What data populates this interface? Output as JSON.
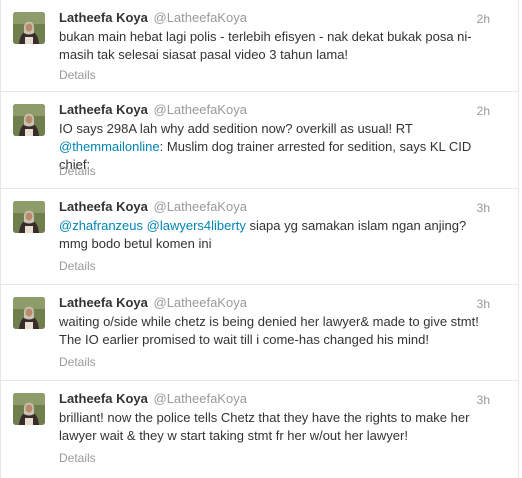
{
  "tweets": [
    {
      "fullname": "Latheefa Koya",
      "username": "@LatheefaKoya",
      "time": "2h",
      "parts": [
        {
          "type": "text",
          "value": "bukan main hebat lagi polis - terlebih efisyen - nak dekat bukak posa ni- masih tak selesai siasat pasal video 3 tahun lama!"
        }
      ],
      "details": "Details"
    },
    {
      "fullname": "Latheefa Koya",
      "username": "@LatheefaKoya",
      "time": "2h",
      "parts": [
        {
          "type": "text",
          "value": "IO says 298A lah why add sedition now? overkill as usual! RT "
        },
        {
          "type": "mention",
          "value": "@themmailonline"
        },
        {
          "type": "text",
          "value": ": Muslim dog trainer arrested for sedition, says KL CID chief:"
        }
      ],
      "details": "Details"
    },
    {
      "fullname": "Latheefa Koya",
      "username": "@LatheefaKoya",
      "time": "3h",
      "parts": [
        {
          "type": "mention",
          "value": "@zhafranzeus"
        },
        {
          "type": "text",
          "value": " "
        },
        {
          "type": "mention",
          "value": "@lawyers4liberty"
        },
        {
          "type": "text",
          "value": " siapa yg samakan islam ngan anjing? mmg bodo betul komen ini"
        }
      ],
      "details": "Details"
    },
    {
      "fullname": "Latheefa Koya",
      "username": "@LatheefaKoya",
      "time": "3h",
      "parts": [
        {
          "type": "text",
          "value": "waiting o/side while chetz is being denied her lawyer& made to give stmt! The IO earlier promised to wait till i come-has changed his mind!"
        }
      ],
      "details": "Details"
    },
    {
      "fullname": "Latheefa Koya",
      "username": "@LatheefaKoya",
      "time": "3h",
      "parts": [
        {
          "type": "text",
          "value": "brilliant! now the police tells Chetz that they have the rights to make her lawyer wait & they w start taking stmt fr her w/out her lawyer!"
        }
      ],
      "details": "Details"
    }
  ],
  "colors": {
    "link": "#0084b4",
    "muted": "#999999",
    "text": "#333333"
  },
  "icons": {
    "avatar": "profile-photo"
  }
}
